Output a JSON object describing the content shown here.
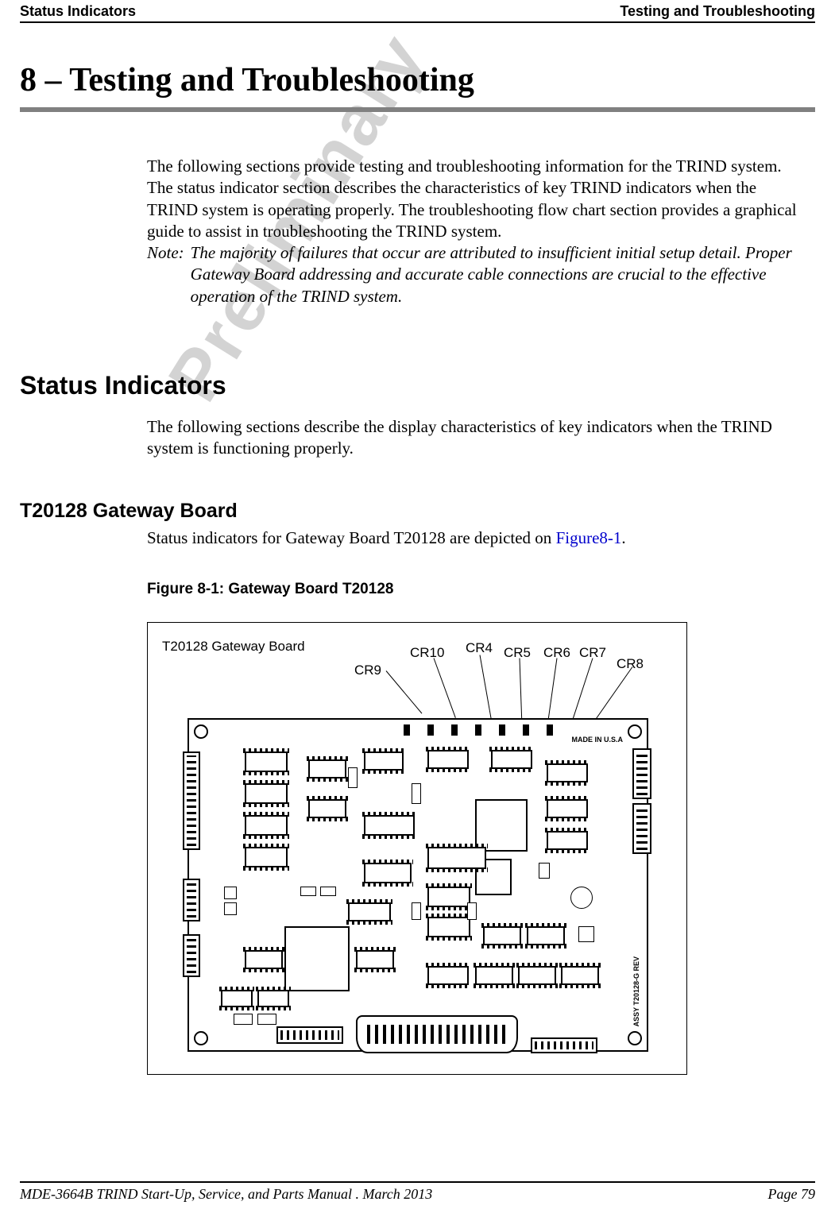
{
  "header": {
    "left": "Status Indicators",
    "right": "Testing and Troubleshooting"
  },
  "chapter_title": "8 – Testing and Troubleshooting",
  "intro_paragraph": "The following sections provide testing and troubleshooting information for the TRIND system. The status indicator section describes the characteristics of key TRIND indicators when the TRIND system is operating properly. The troubleshooting flow chart section provides a graphical guide to assist in troubleshooting the TRIND system.",
  "note_label": "Note:",
  "note_text": "The majority of failures that occur are attributed to insufficient initial setup detail. Proper Gateway Board addressing and accurate cable connections are crucial to the effective operation of the TRIND system.",
  "section_heading": "Status Indicators",
  "section_paragraph": "The following sections describe the display characteristics of key indicators when the TRIND system is functioning properly.",
  "subsection_heading": "T20128 Gateway Board",
  "subsection_text_pre": "Status indicators for Gateway Board T20128 are depicted on ",
  "subsection_link": "Figure8-1",
  "subsection_text_post": ".",
  "figure_caption": "Figure 8-1: Gateway Board T20128",
  "figure": {
    "board_label": "T20128 Gateway Board",
    "callouts": [
      "CR9",
      "CR10",
      "CR4",
      "CR5",
      "CR6",
      "CR7",
      "CR8"
    ],
    "made_label": "MADE IN U.S.A",
    "assy_label": "ASSY T20128-G  REV"
  },
  "watermark": "Preliminary",
  "footer": {
    "doc": "MDE-3664B TRIND Start-Up, Service, and Parts Manual . March 2013",
    "page": "Page 79"
  }
}
